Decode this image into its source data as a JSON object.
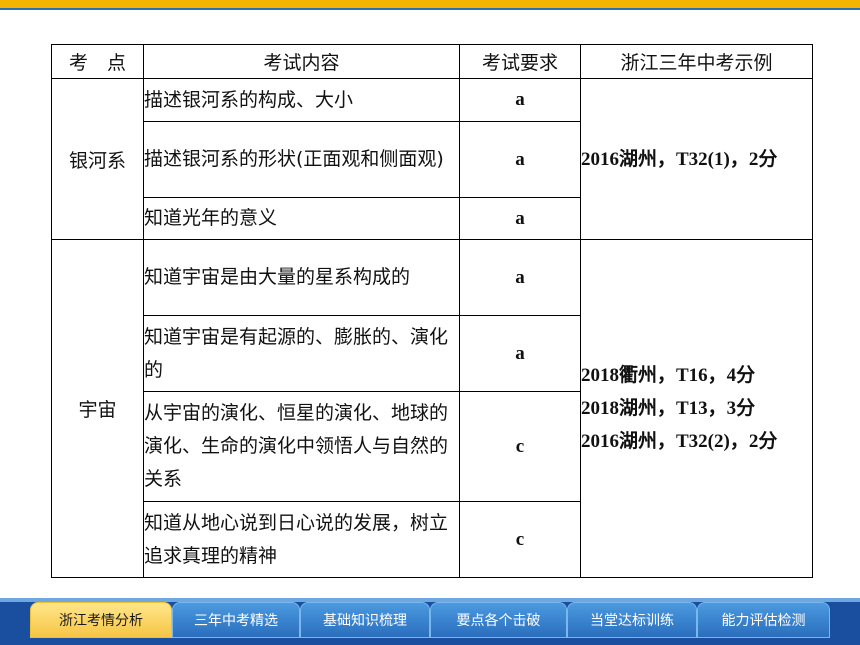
{
  "table": {
    "headers": [
      "考　点",
      "考试内容",
      "考试要求",
      "浙江三年中考示例"
    ],
    "groups": [
      {
        "topic": "银河系",
        "rows": [
          {
            "content": "描述银河系的构成、大小",
            "req": "a"
          },
          {
            "content": "描述银河系的形状(正面观和侧面观)",
            "req": "a"
          },
          {
            "content": "知道光年的意义",
            "req": "a"
          }
        ],
        "examples": [
          "2016湖州，T32(1)，2分"
        ]
      },
      {
        "topic": "宇宙",
        "rows": [
          {
            "content": "知道宇宙是由大量的星系构成的",
            "req": "a"
          },
          {
            "content": "知道宇宙是有起源的、膨胀的、演化的",
            "req": "a"
          },
          {
            "content": "从宇宙的演化、恒星的演化、地球的演化、生命的演化中领悟人与自然的关系",
            "req": "c"
          },
          {
            "content": "知道从地心说到日心说的发展，树立追求真理的精神",
            "req": "c"
          }
        ],
        "examples": [
          "2018衢州，T16，4分",
          "2018湖州，T13，3分",
          "2016湖州，T32(2)，2分"
        ]
      }
    ]
  },
  "nav": {
    "tabs": [
      "浙江考情分析",
      "三年中考精选",
      "基础知识梳理",
      "要点各个击破",
      "当堂达标训练",
      "能力评估检测"
    ],
    "active_index": 0
  }
}
